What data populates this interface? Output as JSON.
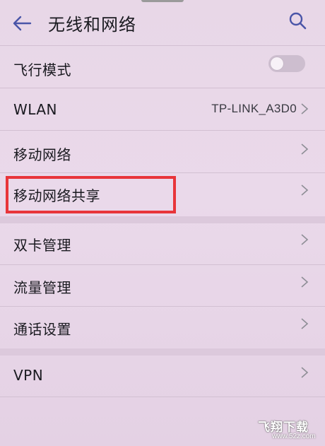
{
  "header": {
    "title": "无线和网络",
    "back_icon": "back-arrow-icon",
    "search_icon": "search-icon"
  },
  "settings": {
    "airplane_mode": {
      "label": "飞行模式",
      "toggle_on": false
    },
    "wlan": {
      "label": "WLAN",
      "value": "TP-LINK_A3D0"
    },
    "mobile_network": {
      "label": "移动网络"
    },
    "tethering": {
      "label": "移动网络共享"
    },
    "dual_sim": {
      "label": "双卡管理"
    },
    "data_usage": {
      "label": "流量管理"
    },
    "call_settings": {
      "label": "通话设置"
    },
    "vpn": {
      "label": "VPN"
    }
  },
  "watermark": {
    "text": "飞翔下载",
    "url": "www.52z.com"
  },
  "colors": {
    "accent": "#4a55a8",
    "highlight": "#e8353a",
    "background": "#e8d7e7"
  }
}
